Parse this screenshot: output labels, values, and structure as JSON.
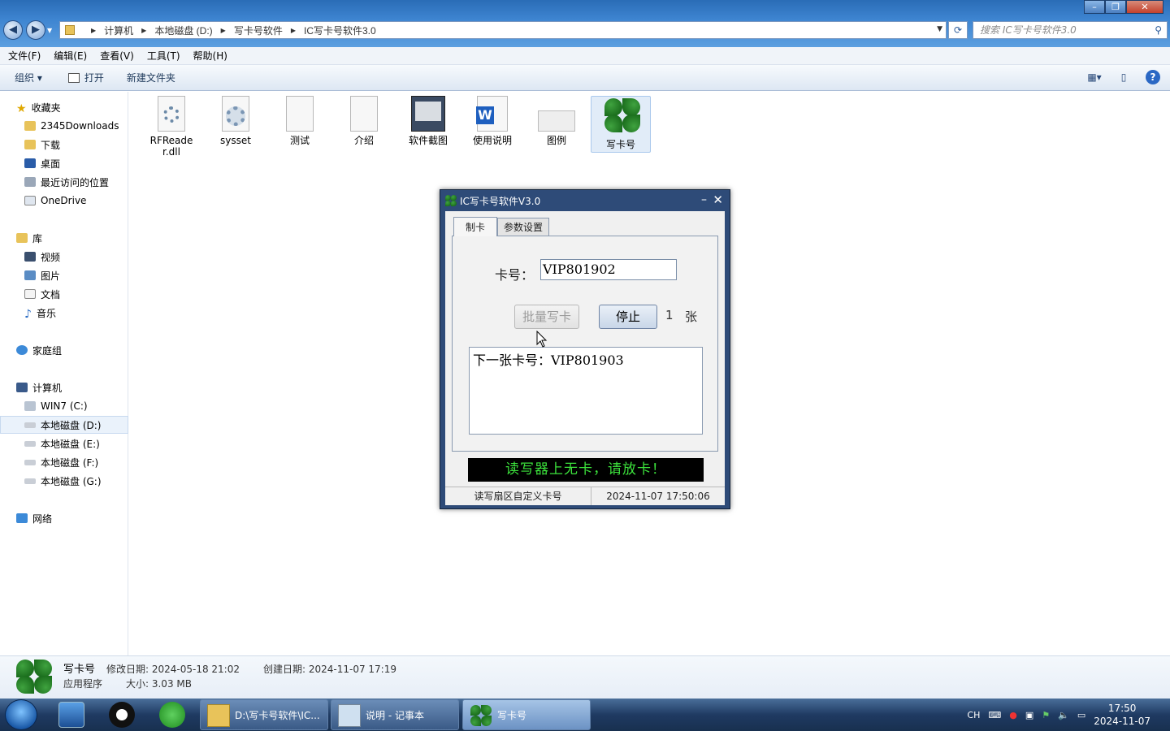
{
  "window": {
    "controls": [
      "–",
      "❐",
      "✕"
    ]
  },
  "address": {
    "crumbs": [
      "计算机",
      "本地磁盘 (D:)",
      "写卡号软件",
      "IC写卡号软件3.0"
    ],
    "search_placeholder": "搜索 IC写卡号软件3.0"
  },
  "menu": [
    "文件(F)",
    "编辑(E)",
    "查看(V)",
    "工具(T)",
    "帮助(H)"
  ],
  "toolbar": {
    "organize": "组织 ▾",
    "open": "打开",
    "new_folder": "新建文件夹"
  },
  "sidebar": {
    "favorites": "收藏夹",
    "fav_items": [
      "2345Downloads",
      "下载",
      "桌面",
      "最近访问的位置",
      "OneDrive"
    ],
    "library": "库",
    "lib_items": [
      "视频",
      "图片",
      "文档",
      "音乐"
    ],
    "homegroup": "家庭组",
    "computer": "计算机",
    "drives": [
      "WIN7 (C:)",
      "本地磁盘 (D:)",
      "本地磁盘 (E:)",
      "本地磁盘 (F:)",
      "本地磁盘 (G:)"
    ],
    "network": "网络"
  },
  "files": [
    {
      "name": "RFReader.dll",
      "icon": "dll-gear-icon"
    },
    {
      "name": "sysset",
      "icon": "config-gear-icon"
    },
    {
      "name": "测试",
      "icon": "text-file-icon"
    },
    {
      "name": "介绍",
      "icon": "text-file-icon"
    },
    {
      "name": "软件截图",
      "icon": "screenshot-icon"
    },
    {
      "name": "使用说明",
      "icon": "word-doc-icon"
    },
    {
      "name": "图例",
      "icon": "image-icon"
    },
    {
      "name": "写卡号",
      "icon": "clover-icon"
    }
  ],
  "details": {
    "name": "写卡号",
    "type": "应用程序",
    "modified": "修改日期: 2024-05-18 21:02",
    "created": "创建日期: 2024-11-07 17:19",
    "size": "大小: 3.03 MB"
  },
  "dialog": {
    "title": "IC写卡号软件V3.0",
    "tabs": [
      "制卡",
      "参数设置"
    ],
    "card_label": "卡号：",
    "card_value": "VIP801902",
    "batch_button": "批量写卡",
    "stop_button": "停止",
    "count": "1",
    "count_unit": "张",
    "output": "下一张卡号：VIP801903",
    "message": "读写器上无卡，请放卡！",
    "status_left": "读写扇区自定义卡号",
    "status_right": "2024-11-07 17:50:06"
  },
  "taskbar": {
    "tasks": [
      "D:\\写卡号软件\\IC...",
      "说明 - 记事本",
      "写卡号"
    ],
    "tray_lang": "CH",
    "time": "17:50",
    "date": "2024-11-07"
  }
}
